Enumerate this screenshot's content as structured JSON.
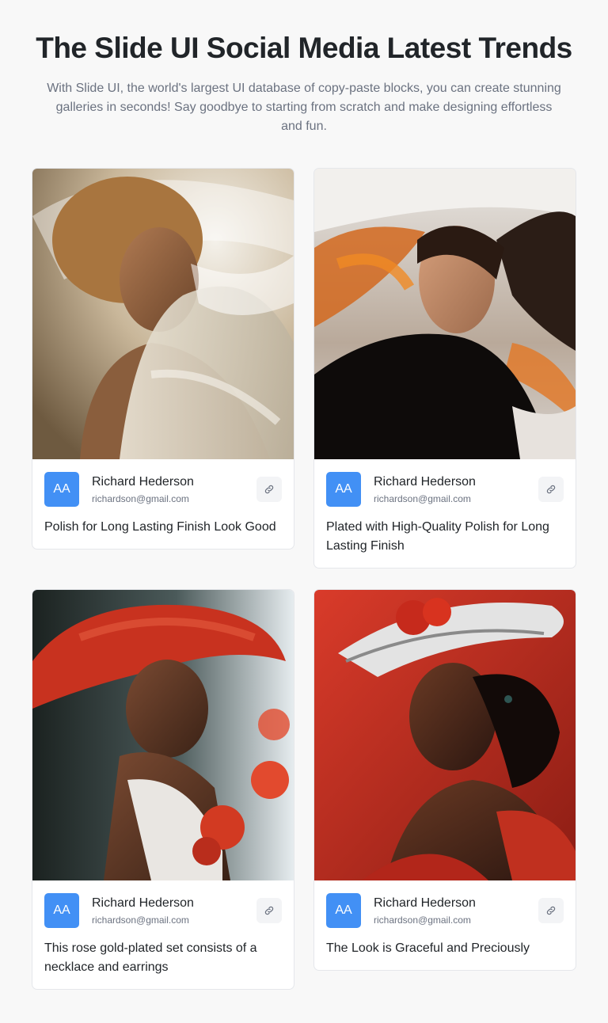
{
  "header": {
    "title": "The Slide UI Social Media Latest Trends",
    "subtitle": "With Slide UI, the world's largest UI database of copy-paste blocks, you can create stunning galleries in seconds! Say goodbye to starting from scratch and make designing effortless and fun."
  },
  "cards": [
    {
      "image": "woman with curly hair in white flowing fabric",
      "author": {
        "initials": "AA",
        "name": "Richard Hederson",
        "email": "richardson@gmail.com"
      },
      "text": "Polish for Long Lasting Finish Look Good",
      "link_icon": "link-icon"
    },
    {
      "image": "woman with windblown hair and orange fabric, black outfit",
      "author": {
        "initials": "AA",
        "name": "Richard Hederson",
        "email": "richardson@gmail.com"
      },
      "text": "Plated with High-Quality Polish for Long Lasting Finish",
      "link_icon": "link-icon"
    },
    {
      "image": "woman in red hat holding red roses",
      "author": {
        "initials": "AA",
        "name": "Richard Hederson",
        "email": "richardson@gmail.com"
      },
      "text": "This rose gold-plated set consists of a necklace and earrings",
      "link_icon": "link-icon"
    },
    {
      "image": "woman in white hat with red flowers and red fabric",
      "author": {
        "initials": "AA",
        "name": "Richard Hederson",
        "email": "richardson@gmail.com"
      },
      "text": "The Look is Graceful and Preciously",
      "link_icon": "link-icon"
    }
  ],
  "colors": {
    "avatar": "#4290f5",
    "background": "#f8f8f8",
    "title": "#212529",
    "muted": "#6b7280"
  }
}
